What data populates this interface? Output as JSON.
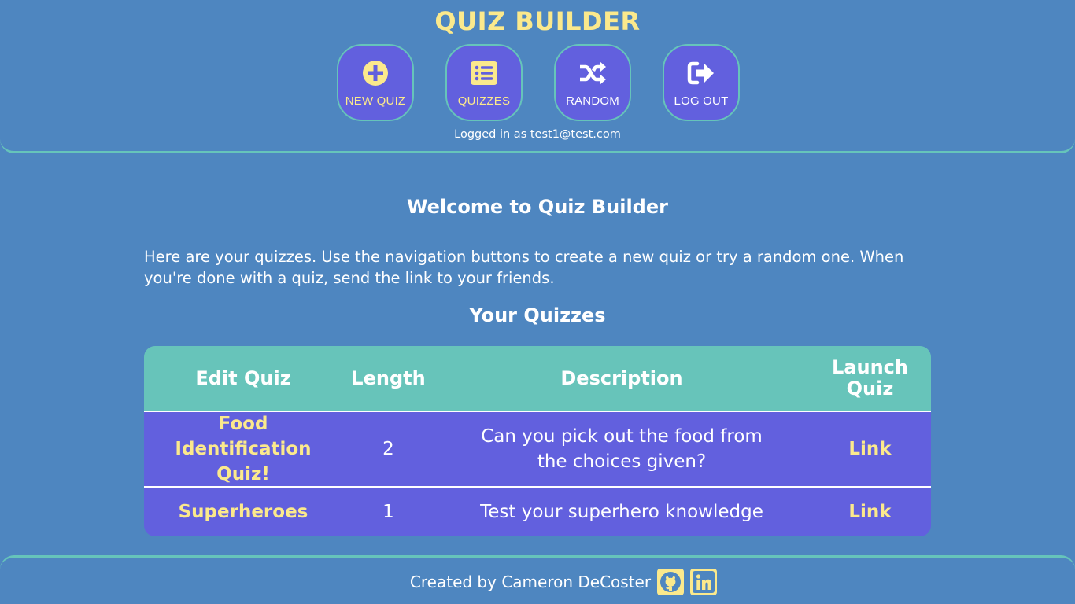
{
  "header": {
    "title": "QUIZ BUILDER",
    "nav": [
      {
        "label": "NEW QUIZ",
        "icon": "plus-circle-icon"
      },
      {
        "label": "QUIZZES",
        "icon": "list-icon"
      },
      {
        "label": "RANDOM",
        "icon": "shuffle-icon"
      },
      {
        "label": "LOG OUT",
        "icon": "sign-out-icon"
      }
    ],
    "logged_in": "Logged in as test1@test.com"
  },
  "main": {
    "welcome": "Welcome to Quiz Builder",
    "intro": "Here are your quizzes. Use the navigation buttons to create a new quiz or try a random one. When you're done with a quiz, send the link to your friends.",
    "quizzes_title": "Your Quizzes",
    "table": {
      "headers": [
        "Edit Quiz",
        "Length",
        "Description",
        "Launch Quiz"
      ],
      "rows": [
        {
          "name": "Food Identification Quiz!",
          "length": "2",
          "description": "Can you pick out the food from the choices given?",
          "link": "Link"
        },
        {
          "name": "Superheroes",
          "length": "1",
          "description": "Test your superhero knowledge",
          "link": "Link"
        }
      ]
    }
  },
  "footer": {
    "credit": "Created by Cameron DeCoster",
    "icons": [
      "github-icon",
      "linkedin-icon"
    ]
  },
  "colors": {
    "background": "#4e86c0",
    "accent_yellow": "#fbe98c",
    "button_purple": "#6260de",
    "teal": "#67c4ba"
  }
}
